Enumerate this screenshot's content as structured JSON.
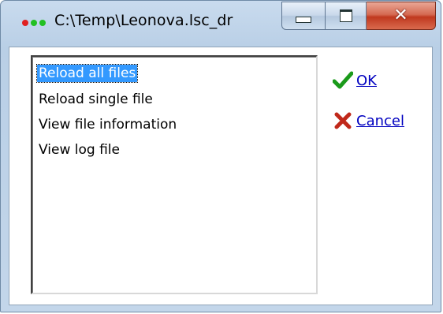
{
  "window": {
    "title": "C:\\Temp\\Leonova.lsc_dr",
    "colors": {
      "frame": "#b9cfe6",
      "close": "#c0391f"
    }
  },
  "caption_buttons": {
    "minimize": "minimize-icon",
    "maximize": "maximize-icon",
    "close": "close-icon"
  },
  "list": {
    "selected_index": 0,
    "items": [
      {
        "label": "Reload all files"
      },
      {
        "label": "Reload single file"
      },
      {
        "label": "View file information"
      },
      {
        "label": "View log file"
      }
    ]
  },
  "actions": {
    "ok": {
      "label": "OK",
      "icon": "checkmark-icon",
      "color": "#1a9a1a"
    },
    "cancel": {
      "label": "Cancel",
      "icon": "red-x-icon",
      "color": "#c0281a"
    }
  }
}
